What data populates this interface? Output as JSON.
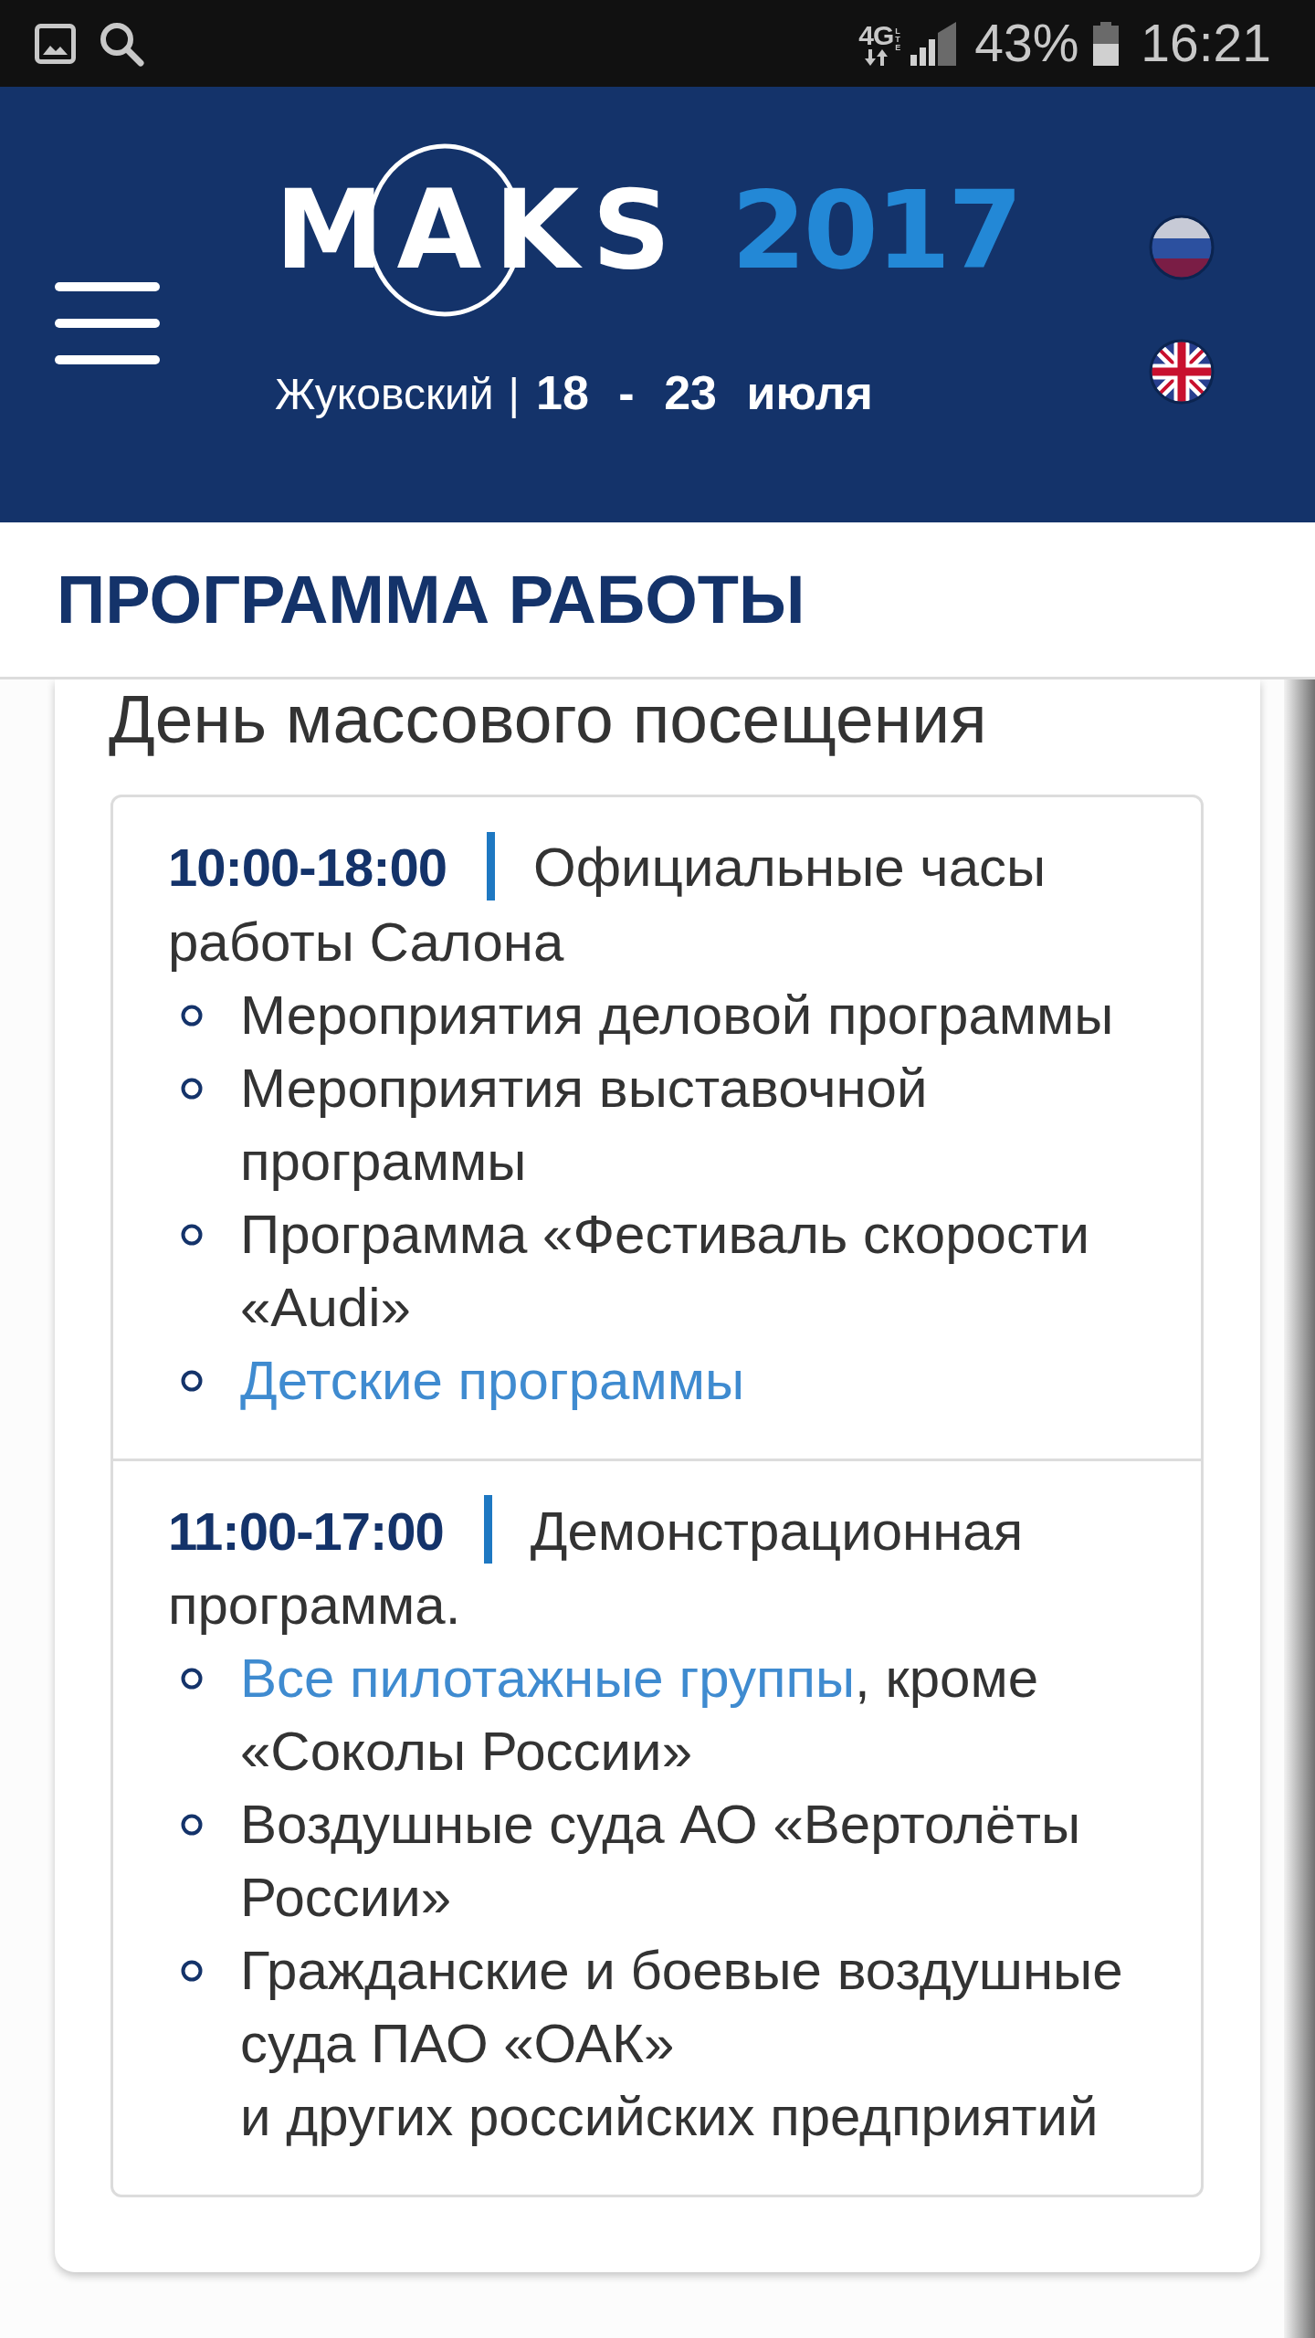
{
  "status_bar": {
    "network": "4G",
    "network_sub": "LTE",
    "battery_percent": "43%",
    "time": "16:21"
  },
  "header": {
    "logo": {
      "name": "MAKS",
      "year": "2017"
    },
    "location": "Жуковский",
    "separator": "|",
    "dates": "18 - 23 июля",
    "languages": [
      {
        "kind": "ru"
      },
      {
        "kind": "en"
      }
    ]
  },
  "page_title": "ПРОГРАММА РАБОТЫ",
  "day": {
    "title": "День массового посещения",
    "sections": [
      {
        "time": "10:00-18:00",
        "description": "Официальные часы работы Салона",
        "items": [
          {
            "parts": [
              {
                "kind": "text",
                "text": "Мероприятия деловой программы"
              }
            ]
          },
          {
            "parts": [
              {
                "kind": "text",
                "text": "Мероприятия выставочной программы"
              }
            ]
          },
          {
            "parts": [
              {
                "kind": "text",
                "text": "Программа «Фестиваль скорости «Audi»"
              }
            ]
          },
          {
            "parts": [
              {
                "kind": "link",
                "text": "Детские программы"
              }
            ]
          }
        ]
      },
      {
        "time": "11:00-17:00",
        "description": "Демонстрационная программа.",
        "items": [
          {
            "parts": [
              {
                "kind": "link",
                "text": "Все пилотажные группы"
              },
              {
                "kind": "text",
                "text": ", кроме «Соколы России»"
              }
            ]
          },
          {
            "parts": [
              {
                "kind": "text",
                "text": "Воздушные суда АО «Вертолёты России»"
              }
            ]
          },
          {
            "parts": [
              {
                "kind": "text",
                "text": "Гражданские и боевые воздушные суда ПАО «ОАК»\nи других российских предприятий"
              }
            ]
          }
        ]
      }
    ]
  }
}
